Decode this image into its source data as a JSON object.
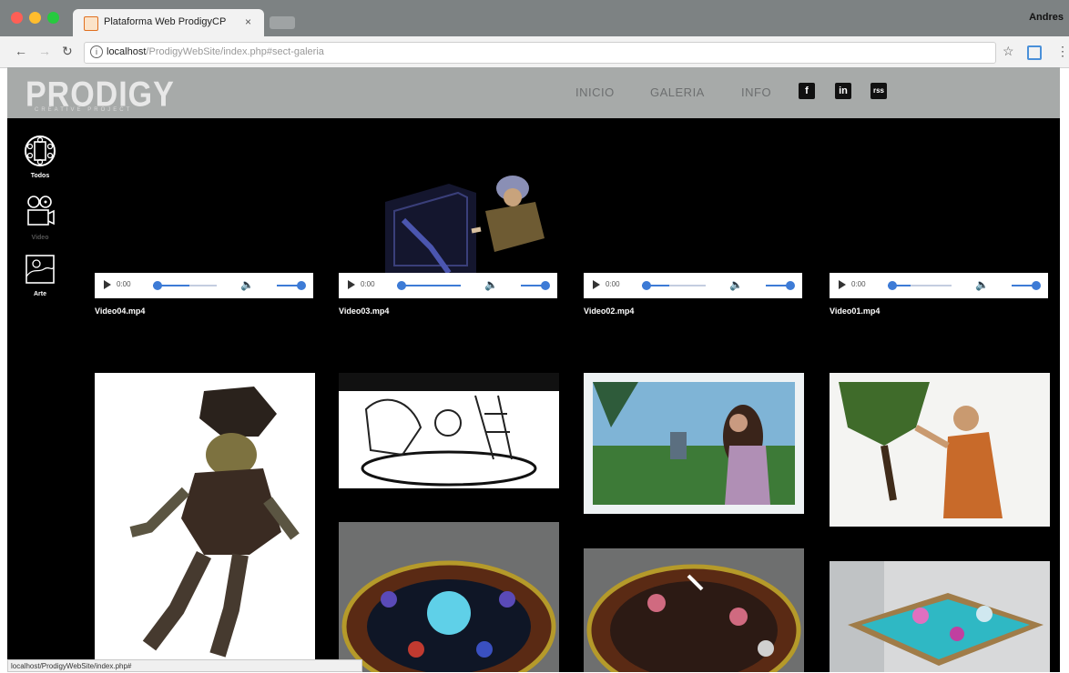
{
  "browser": {
    "tab_title": "Plataforma Web ProdigyCP",
    "tab_close": "×",
    "user": "Andres",
    "url_host": "localhost",
    "url_path": "/ProdigyWebSite/index.php#sect-galeria",
    "status_url": "localhost/ProdigyWebSite/index.php#"
  },
  "site": {
    "logo": "PRODIGY",
    "logo_sub": "CREATIVE PROJECT",
    "nav": [
      "INICIO",
      "GALERIA",
      "INFO"
    ],
    "social": [
      "f",
      "in",
      "rss"
    ]
  },
  "sidebar": {
    "items": [
      {
        "label": "Todos",
        "icon": "film-reel-icon"
      },
      {
        "label": "Video",
        "icon": "video-camera-icon"
      },
      {
        "label": "Arte",
        "icon": "image-icon"
      }
    ]
  },
  "videos": [
    {
      "name": "Video04.mp4",
      "time": "0:00"
    },
    {
      "name": "Video03.mp4",
      "time": "0:00"
    },
    {
      "name": "Video02.mp4",
      "time": "0:00"
    },
    {
      "name": "Video01.mp4",
      "time": "0:00"
    }
  ],
  "colors": {
    "accent": "#3d7bd6",
    "header": "#a7aaa9",
    "chrome": "#7d8283"
  }
}
